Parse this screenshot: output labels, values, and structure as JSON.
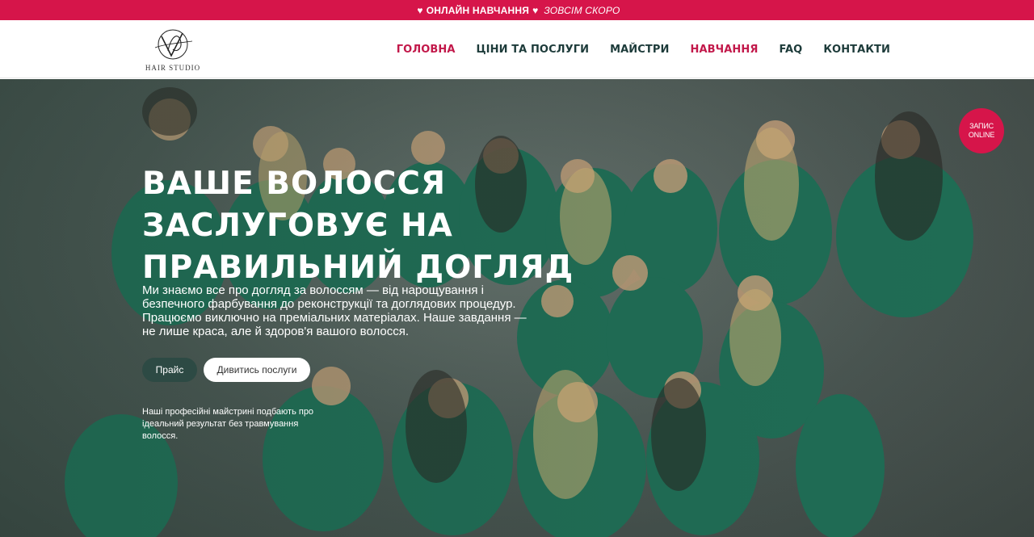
{
  "promo": {
    "heart_icon": "heart-icon",
    "strong_text": "ОНЛАЙН НАВЧАННЯ",
    "em_text": "ЗОВСІМ СКОРО"
  },
  "logo": {
    "text": "HAIR STUDIO"
  },
  "nav": {
    "items": [
      {
        "label": "ГОЛОВНА",
        "active": true
      },
      {
        "label": "ЦІНИ ТА ПОСЛУГИ",
        "active": false
      },
      {
        "label": "МАЙСТРИ",
        "active": false
      },
      {
        "label": "НАВЧАННЯ",
        "active": true
      },
      {
        "label": "FAQ",
        "active": false
      },
      {
        "label": "КОНТАКТИ",
        "active": false
      }
    ]
  },
  "hero": {
    "title_line1": "ВАШЕ ВОЛОССЯ",
    "title_line2": "ЗАСЛУГОВУЄ НА",
    "title_line3": "ПРАВИЛЬНИЙ ДОГЛЯД",
    "description": "Ми знаємо все про догляд за волоссям — від нарощування і безпечного фарбування до реконструкції та доглядових процедур. Працюємо виключно на преміальних матеріалах. Наше завдання — не лише краса, але й здоров'я вашого волосся.",
    "btn_price": "Прайс",
    "btn_services": "Дивитись послуги",
    "note": "Наші професійні майстрині подбають про ідеальний результат без травмування волосся."
  },
  "badge": {
    "line1": "ЗАПИС",
    "line2": "ONLINE"
  },
  "colors": {
    "accent": "#d6154a",
    "nav_text": "#1d3b3a",
    "button_dark": "#2d4a44",
    "shirt_green": "#1f6e56"
  }
}
